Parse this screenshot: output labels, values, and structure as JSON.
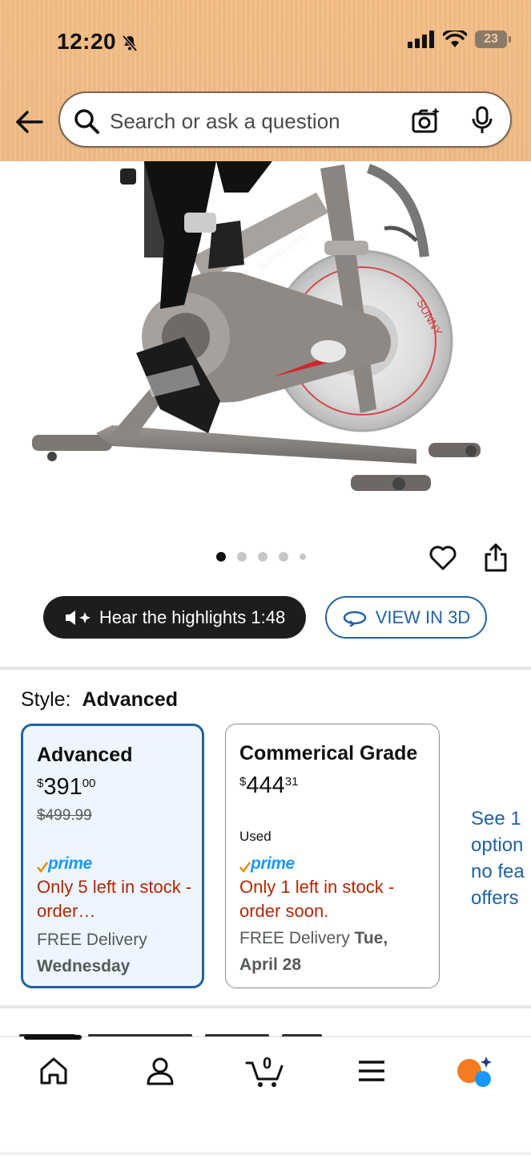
{
  "status_bar": {
    "time": "12:20",
    "battery": "23"
  },
  "search": {
    "placeholder": "Search or ask a question"
  },
  "product_image": {
    "alt": "Sunny Health & Fitness indoor cycling bike",
    "brand_text_frame": "SUNNY BIKE",
    "brand_text_flywheel": "SUNNY",
    "brand_text_hub": "SUNNY"
  },
  "carousel": {
    "total": 5,
    "active": 0
  },
  "actions": {
    "hear_label": "Hear the highlights 1:48",
    "view3d_label": "VIEW IN 3D"
  },
  "style": {
    "label": "Style:",
    "value": "Advanced"
  },
  "options": [
    {
      "title": "Advanced",
      "price_symbol": "$",
      "price_whole": "391",
      "price_fraction": "00",
      "was_price": "$499.99",
      "used": "",
      "prime": "prime",
      "stock": "Only 5 left in stock - order…",
      "delivery_prefix": "FREE Delivery",
      "delivery_day": "Wednesday",
      "selected": true
    },
    {
      "title": "Commerical Grade",
      "price_symbol": "$",
      "price_whole": "444",
      "price_fraction": "31",
      "was_price": "",
      "used": "Used",
      "prime": "prime",
      "stock": "Only 1 left in stock - order soon.",
      "delivery_prefix": "FREE Delivery",
      "delivery_day": "Tue, April 28",
      "selected": false
    }
  ],
  "see_more": {
    "line1": "See 1",
    "line2": "option",
    "line3": "no fea",
    "line4": "offers"
  },
  "bottom_nav": {
    "items": [
      "home",
      "account",
      "cart",
      "menu",
      "rufus"
    ],
    "cart_count": "0"
  },
  "colors": {
    "header_bg": "#f0bc86",
    "link_blue": "#2162a1",
    "stock_red": "#b12704",
    "prime_blue": "#1a98ff",
    "prime_check": "#f08804"
  }
}
